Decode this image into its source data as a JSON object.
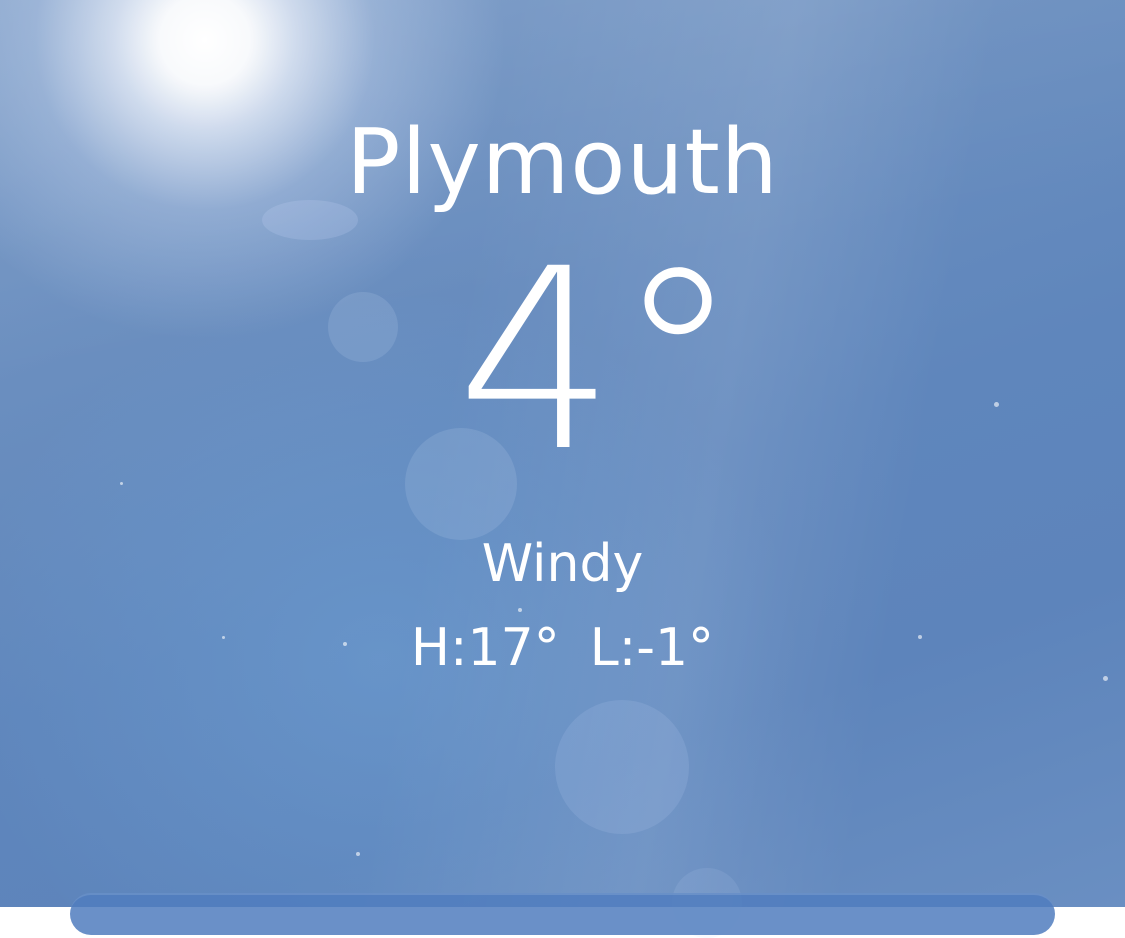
{
  "location": {
    "city": "Plymouth"
  },
  "current": {
    "temperature": "4°",
    "condition": "Windy",
    "high": "H:17°",
    "low": "L:-1°"
  },
  "theme": {
    "sky_color": "#6a8ebf",
    "text_color": "#ffffff"
  }
}
